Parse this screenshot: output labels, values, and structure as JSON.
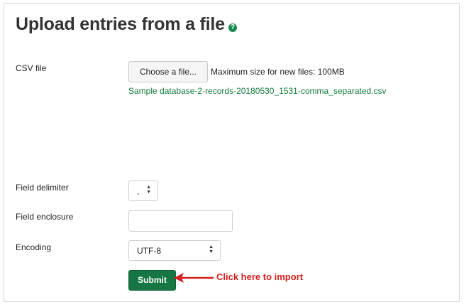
{
  "page": {
    "title": "Upload entries from a file",
    "help_icon": "question-icon"
  },
  "form": {
    "csv_file": {
      "label": "CSV file",
      "button_label": "Choose a file...",
      "max_size_text": "Maximum size for new files: 100MB",
      "selected_file": "Sample database-2-records-20180530_1531-comma_separated.csv"
    },
    "field_delimiter": {
      "label": "Field delimiter",
      "value": ","
    },
    "field_enclosure": {
      "label": "Field enclosure",
      "value": ""
    },
    "encoding": {
      "label": "Encoding",
      "value": "UTF-8"
    },
    "submit_label": "Submit"
  },
  "annotation": {
    "text": "Click here to import",
    "color": "#d41f1f"
  },
  "colors": {
    "primary": "#177744",
    "link": "#117a3a"
  }
}
